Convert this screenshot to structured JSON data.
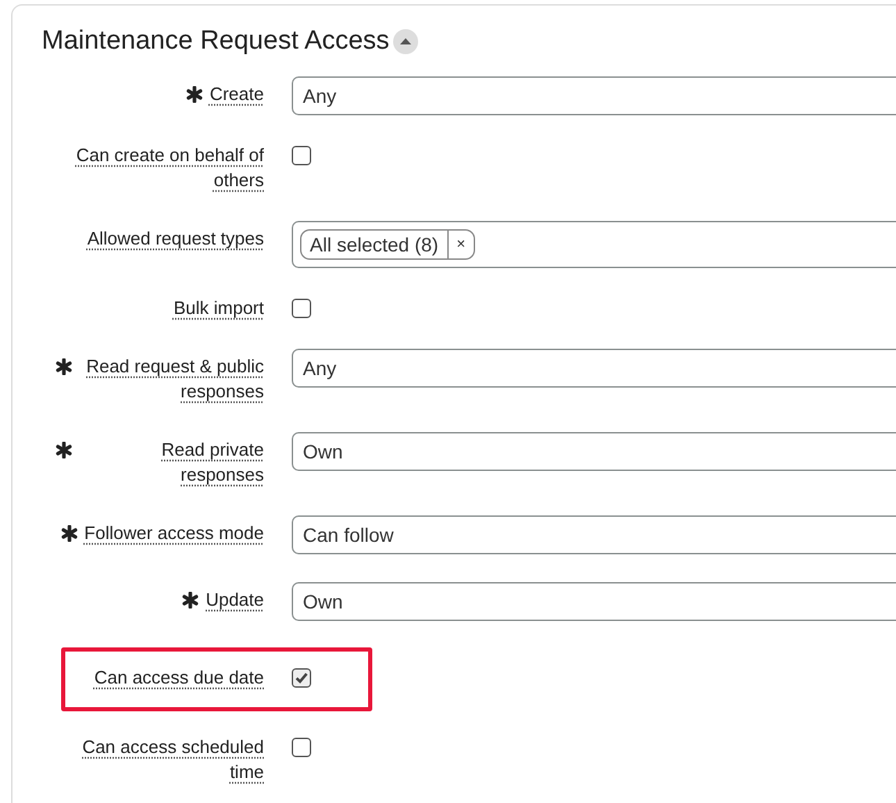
{
  "section": {
    "title": "Maintenance Request Access",
    "expanded": true
  },
  "rows": [
    {
      "label": "Create",
      "required": true,
      "kind": "select",
      "value": "Any"
    },
    {
      "label": "Can create on behalf of others",
      "required": false,
      "kind": "checkbox",
      "checked": false
    },
    {
      "label": "Allowed request types",
      "required": false,
      "kind": "multiselect",
      "tags": [
        {
          "text": "All selected (8)",
          "remove": "×"
        }
      ]
    },
    {
      "label": "Bulk import",
      "required": false,
      "kind": "checkbox",
      "checked": false
    },
    {
      "label": "Read request & public responses",
      "required": true,
      "kind": "select",
      "value": "Any"
    },
    {
      "label": "Read private responses",
      "required": true,
      "kind": "select",
      "value": "Own"
    },
    {
      "label": "Follower access mode",
      "required": true,
      "kind": "select",
      "value": "Can follow"
    },
    {
      "label": "Update",
      "required": true,
      "kind": "select",
      "value": "Own"
    },
    {
      "label": "Can access due date",
      "required": false,
      "kind": "checkbox",
      "checked": true,
      "highlighted": true
    },
    {
      "label": "Can access scheduled time",
      "required": false,
      "kind": "checkbox",
      "checked": false
    }
  ]
}
